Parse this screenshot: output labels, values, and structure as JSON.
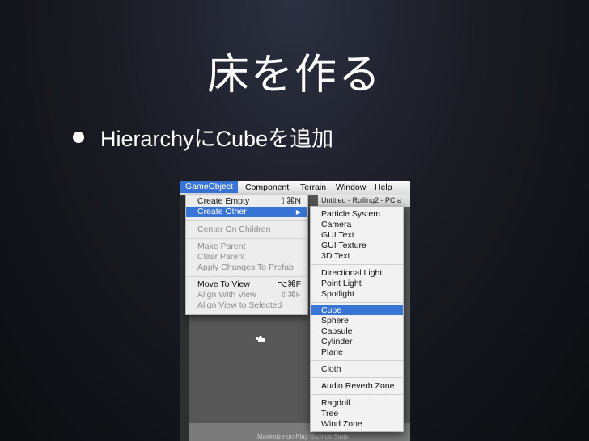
{
  "slide": {
    "title": "床を作る",
    "bullet": "HierarchyにCubeを追加"
  },
  "menubar": {
    "items": [
      "GameObject",
      "Component",
      "Terrain",
      "Window",
      "Help"
    ],
    "active": "GameObject"
  },
  "window_title": "Untitled - Rolling2 - PC a",
  "gameobject_menu": {
    "items": [
      {
        "label": "Create Empty",
        "shortcut": "⇧⌘N",
        "enabled": true
      },
      {
        "label": "Create Other",
        "submenu": true,
        "selected": true
      },
      {
        "label": "Center On Children",
        "enabled": false
      },
      {
        "label": "Make Parent",
        "enabled": false
      },
      {
        "label": "Clear Parent",
        "enabled": false
      },
      {
        "label": "Apply Changes To Prefab",
        "enabled": false
      },
      {
        "label": "Move To View",
        "shortcut": "⌥⌘F",
        "enabled": true
      },
      {
        "label": "Align With View",
        "shortcut": "⇧⌘F",
        "enabled": false
      },
      {
        "label": "Align View to Selected",
        "enabled": false
      }
    ]
  },
  "create_other_menu": {
    "items": [
      "Particle System",
      "Camera",
      "GUI Text",
      "GUI Texture",
      "3D Text",
      "Directional Light",
      "Point Light",
      "Spotlight",
      "Cube",
      "Sphere",
      "Capsule",
      "Cylinder",
      "Plane",
      "Cloth",
      "Audio Reverb Zone",
      "Ragdoll...",
      "Tree",
      "Wind Zone"
    ],
    "selected": "Cube"
  },
  "bottom_text": "Maximize on Play  Gizmos  Stats",
  "colors": {
    "highlight": "#3875d7"
  }
}
